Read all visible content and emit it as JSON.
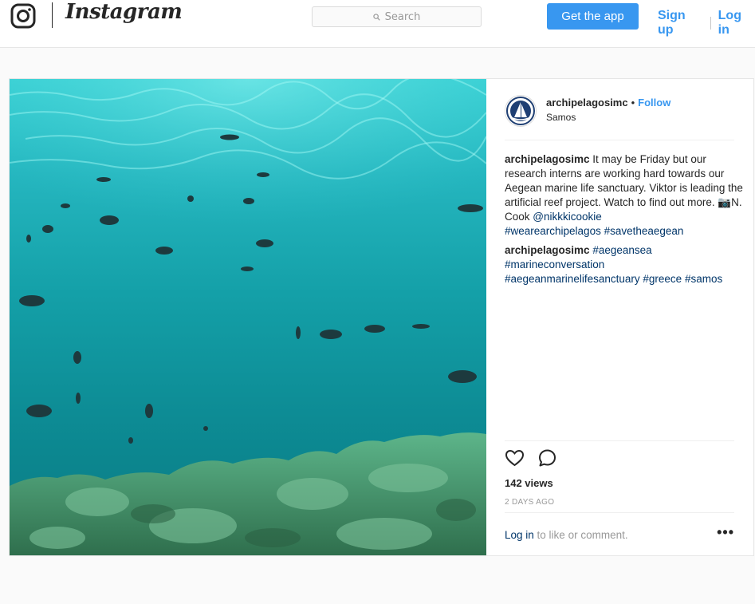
{
  "header": {
    "logo_icon": "instagram-camera-icon",
    "wordmark": "Instagram",
    "search_placeholder": "Search",
    "search_icon": "search-icon",
    "get_app_label": "Get the app",
    "signup_label": "Sign up",
    "login_label": "Log in"
  },
  "post": {
    "media": {
      "type": "video",
      "description_icon": "video-player"
    },
    "owner": {
      "username": "archipelagosimc",
      "separator": "•",
      "follow_label": "Follow",
      "location": "Samos",
      "avatar_icon": "sailboat-logo-avatar"
    },
    "caption": {
      "username": "archipelagosimc",
      "text": " It may be Friday but our research interns are working hard towards our Aegean marine life sanctuary. Viktor is leading the artificial reef project. Watch to find out more. ",
      "camera_emoji": "📷",
      "credit": "N. Cook ",
      "mention": "@nikkkicookie",
      "tags": [
        "#wearearchipelagos",
        "#savetheaegean"
      ]
    },
    "comment": {
      "username": "archipelagosimc",
      "tags": [
        "#aegeansea",
        "#marineconversation",
        "#aegeanmarinelifesanctuary",
        "#greece",
        "#samos"
      ]
    },
    "actions": {
      "like_icon": "heart-icon",
      "comment_icon": "comment-bubble-icon"
    },
    "views": "142 views",
    "age": "2 DAYS AGO",
    "login_prompt": {
      "link": "Log in",
      "rest": " to like or comment."
    },
    "more_label": "•••"
  },
  "colors": {
    "accent": "#3897f0",
    "link": "#003569",
    "water_top": "#39d0d4",
    "water_bottom": "#0a7a82"
  }
}
